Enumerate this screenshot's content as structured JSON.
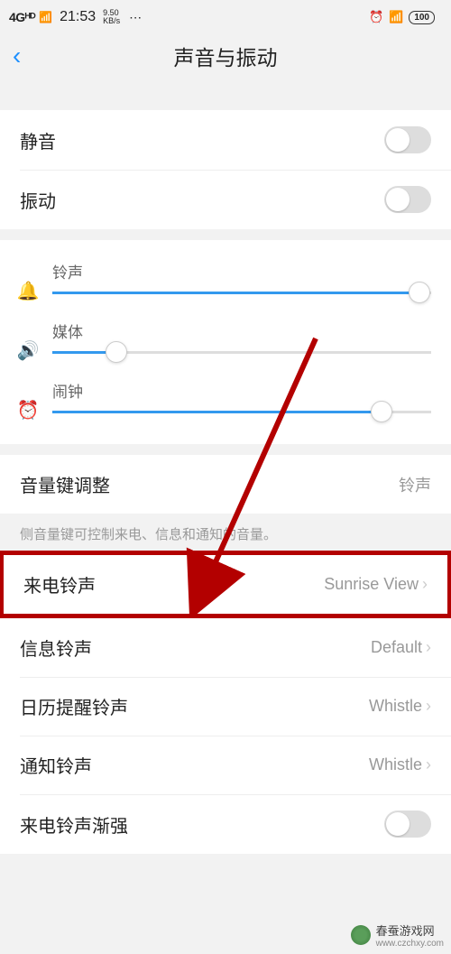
{
  "statusBar": {
    "signal": "4Gᴴᴰ",
    "bars": "ılıl",
    "time": "21:53",
    "speedValue": "9.50",
    "speedUnit": "KB/s",
    "battery": "100"
  },
  "header": {
    "title": "声音与振动"
  },
  "toggles": {
    "mute": "静音",
    "vibrate": "振动"
  },
  "sliders": {
    "ringtone": {
      "label": "铃声",
      "percent": 97
    },
    "media": {
      "label": "媒体",
      "percent": 17
    },
    "alarm": {
      "label": "闹钟",
      "percent": 87
    }
  },
  "volumeKey": {
    "label": "音量键调整",
    "value": "铃声",
    "hint": "侧音量键可控制来电、信息和通知的音量。"
  },
  "ringtones": {
    "incoming": {
      "label": "来电铃声",
      "value": "Sunrise View"
    },
    "message": {
      "label": "信息铃声",
      "value": "Default"
    },
    "calendar": {
      "label": "日历提醒铃声",
      "value": "Whistle"
    },
    "notification": {
      "label": "通知铃声",
      "value": "Whistle"
    },
    "ascending": {
      "label": "来电铃声渐强"
    }
  },
  "watermark": {
    "site": "春蚕游戏网",
    "url": "www.czchxy.com"
  }
}
